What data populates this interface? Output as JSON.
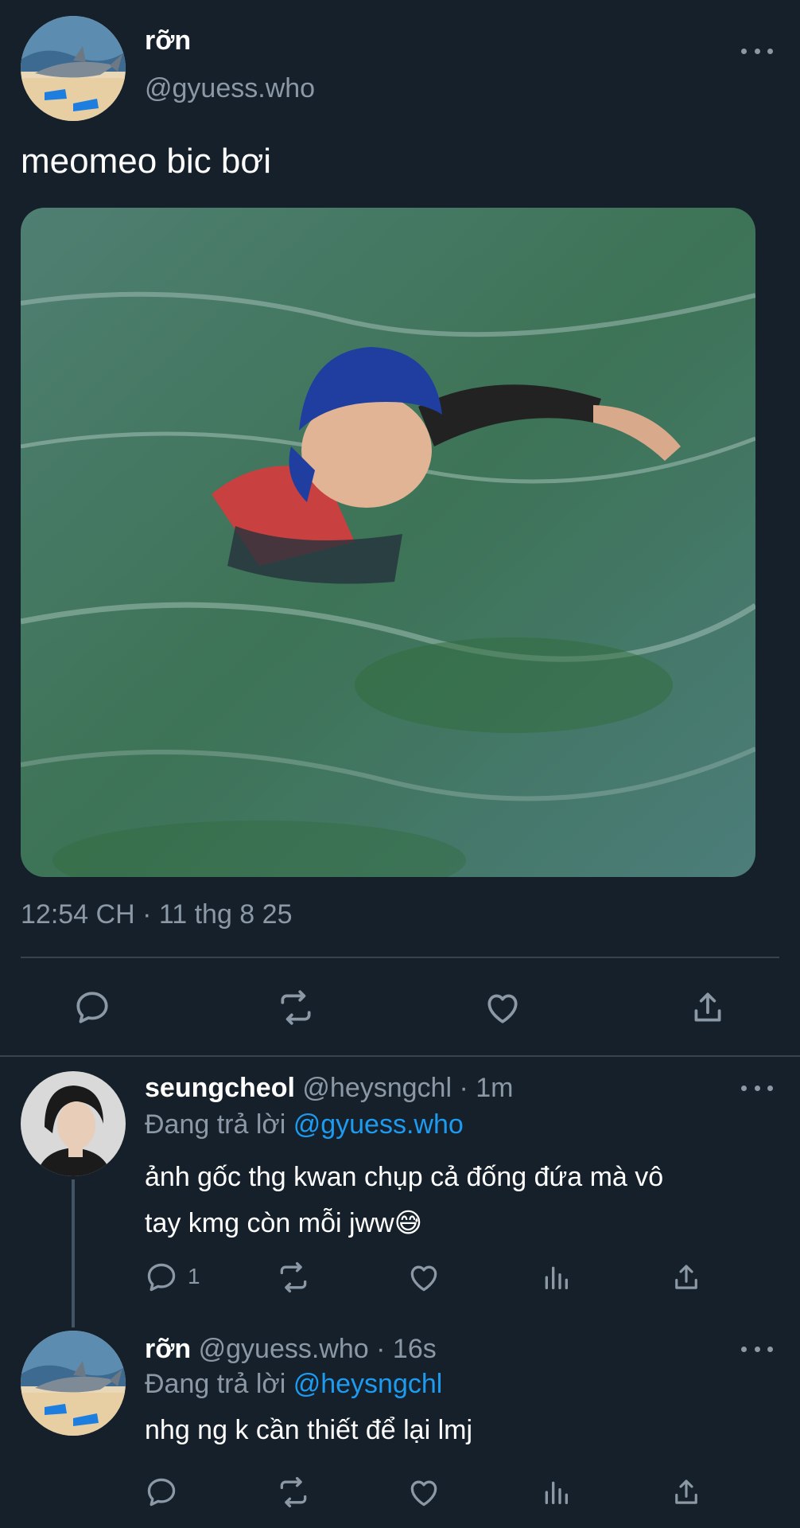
{
  "main_tweet": {
    "display_name": "rỡn",
    "handle": "@gyuess.who",
    "text": "meomeo bic bơi",
    "timestamp": "12:54 CH · 11 thg 8 25"
  },
  "replies": [
    {
      "display_name": "seungcheol",
      "handle": "@heysngchl",
      "time": "· 1m",
      "replying_prefix": "Đang trả lời",
      "replying_to": "@gyuess.who",
      "text_line1": "ảnh gốc thg kwan chụp cả đống đứa mà vô",
      "text_line2": "tay kmg còn mỗi jww😅",
      "reply_count": "1"
    },
    {
      "display_name": "rỡn",
      "handle": "@gyuess.who",
      "time": "· 16s",
      "replying_prefix": "Đang trả lời",
      "replying_to": "@heysngchl",
      "text": "nhg ng k cần thiết để lại lmj"
    }
  ],
  "icons": {
    "reply": "reply-icon",
    "retweet": "retweet-icon",
    "like": "heart-icon",
    "views": "views-icon",
    "share": "share-icon",
    "more": "more-icon"
  },
  "colors": {
    "background": "#15202b",
    "text": "#ffffff",
    "muted": "#8b98a5",
    "link": "#1d9bf0",
    "divider": "#38444d"
  }
}
